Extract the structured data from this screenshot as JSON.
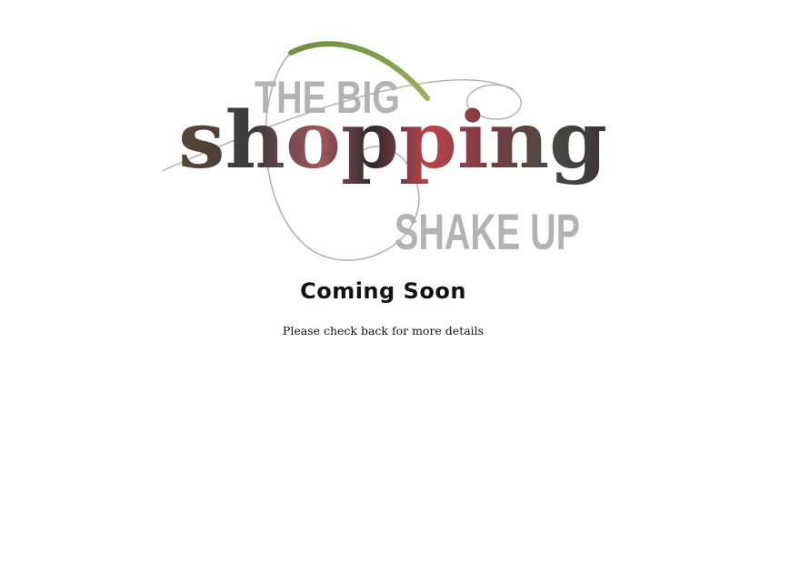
{
  "logo": {
    "line1": "THE BIG",
    "line2": "shopping",
    "line3": "SHAKE UP",
    "grey_color": "#b3b3b3"
  },
  "heading": "Coming Soon",
  "subtitle": "Please check back for more details"
}
